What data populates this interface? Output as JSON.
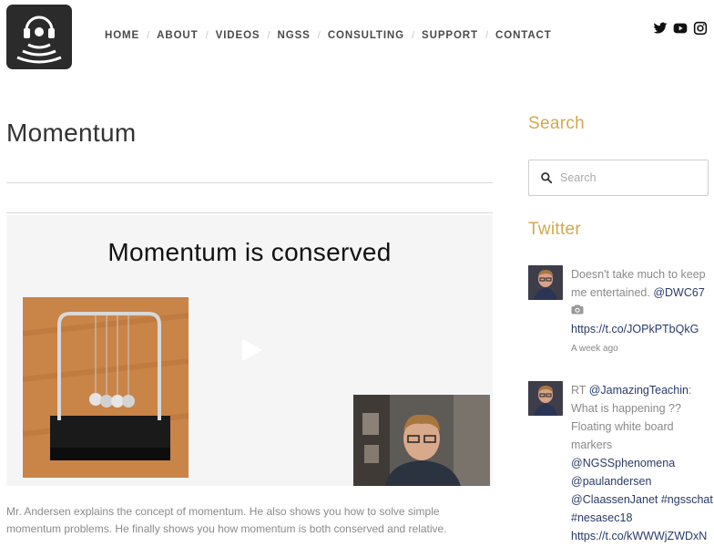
{
  "header": {
    "nav": [
      {
        "label": "HOME"
      },
      {
        "label": "ABOUT"
      },
      {
        "label": "VIDEOS"
      },
      {
        "label": "NGSS"
      },
      {
        "label": "CONSULTING"
      },
      {
        "label": "SUPPORT"
      },
      {
        "label": "CONTACT"
      }
    ],
    "social_icons": [
      "twitter-icon",
      "youtube-icon",
      "instagram-icon"
    ]
  },
  "main": {
    "title": "Momentum",
    "video": {
      "slide_title": "Momentum is conserved"
    },
    "description": "Mr. Andersen explains the concept of momentum. He also shows you how to solve simple momentum problems. He finally shows you how momentum is both conserved and relative."
  },
  "sidebar": {
    "search_heading": "Search",
    "search_placeholder": "Search",
    "twitter_heading": "Twitter",
    "tweets": [
      {
        "text": "Doesn't take much to keep me entertained. ",
        "mention": "@DWC67",
        "link": "https://t.co/JOPkPTbQkG",
        "time": "A week ago"
      },
      {
        "prefix": "RT ",
        "mention": "@JamazingTeachin",
        "text": ": What is happening ?? Floating white board markers ",
        "mentions": "@NGSSphenomena @paulandersen @ClaassenJanet #ngsschat #nesasec18",
        "link": "https://t.co/kWWWjZWDxN"
      }
    ]
  },
  "colors": {
    "accent": "#d4a84f",
    "link": "#2a3a6a",
    "logo_bg": "#2b2b2b"
  }
}
